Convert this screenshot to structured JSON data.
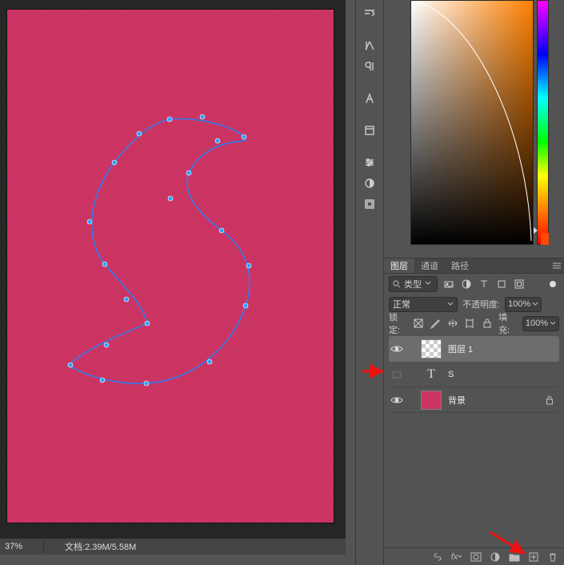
{
  "status": {
    "zoom": "37%",
    "doc": "文档:2.39M/5.58M"
  },
  "toolbar": {
    "items": [
      {
        "name": "panel-options-icon"
      },
      {
        "name": "align-icon"
      },
      {
        "name": "paragraph-direction-icon"
      },
      {
        "name": "glyphs-icon"
      },
      {
        "name": "properties-icon"
      },
      {
        "name": "adjustments-icon"
      },
      {
        "name": "brush-icon"
      },
      {
        "name": "libraries-icon"
      }
    ]
  },
  "tabs": {
    "layers": "图层",
    "channels": "通道",
    "paths": "路径"
  },
  "kind": {
    "label": "类型"
  },
  "blend": {
    "mode": "正常",
    "opacity_label": "不透明度:",
    "opacity_value": "100%"
  },
  "lock": {
    "label": "锁定:",
    "fill_label": "填充:",
    "fill_value": "100%"
  },
  "layers_list": [
    {
      "name": "图层 1",
      "type": "raster",
      "visible": true,
      "selected": true
    },
    {
      "name": "S",
      "type": "text",
      "visible": false,
      "selected": false
    },
    {
      "name": "背景",
      "type": "bg",
      "visible": true,
      "selected": false,
      "locked": true
    }
  ],
  "chart_data": {
    "type": "swatches",
    "hue_selected_deg": 18,
    "current_color_hex": "#ff4800"
  }
}
